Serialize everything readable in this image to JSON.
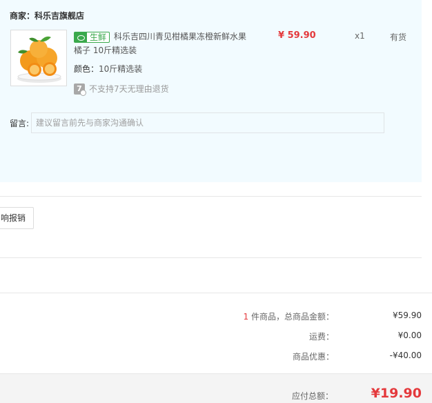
{
  "shop": {
    "label": "商家：",
    "name": "科乐吉旗舰店"
  },
  "product": {
    "tag": "生鲜",
    "tag_icon": "fish-icon",
    "name": "科乐吉四川青见柑橘果冻橙新鲜水果橘子 10斤精选装",
    "color_label": "颜色：",
    "color_value": "10斤精选装",
    "no_return_icon": "7",
    "no_return_text": "不支持7天无理由退货",
    "price": "¥ 59.90",
    "qty": "x1",
    "stock": "有货"
  },
  "remark": {
    "label": "留言:",
    "placeholder": "建议留言前先与商家沟通确认",
    "value": ""
  },
  "invoice_button": "响报销",
  "summary": {
    "count": "1",
    "items_label": " 件商品，总商品金额：",
    "items_value": "¥59.90",
    "shipping_label": "运费：",
    "shipping_value": "¥0.00",
    "discount_label": "商品优惠：",
    "discount_value": "-¥40.00",
    "total_label": "应付总额：",
    "total_value": "¥19.90"
  },
  "colors": {
    "accent_red": "#e4393c",
    "fresh_green": "#3aa94c",
    "shop_bg": "#f2fbff"
  }
}
